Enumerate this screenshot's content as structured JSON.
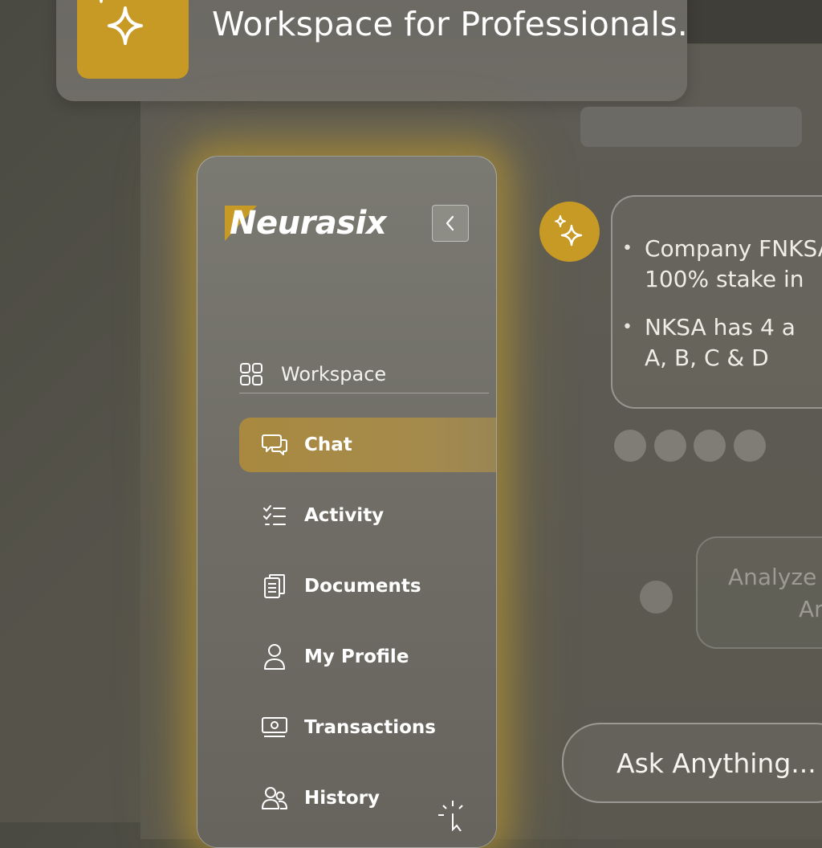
{
  "banner": {
    "title": "Workspace for Professionals.",
    "icon": "sparkles-icon"
  },
  "sidebar": {
    "brand": "Neurasix",
    "collapse_icon": "chevron-left-icon",
    "workspace_label": "Workspace",
    "items": [
      {
        "label": "Chat",
        "icon": "chat-bubbles-icon",
        "active": true
      },
      {
        "label": "Activity",
        "icon": "checklist-icon",
        "active": false
      },
      {
        "label": "Documents",
        "icon": "documents-icon",
        "active": false
      },
      {
        "label": "My Profile",
        "icon": "user-icon",
        "active": false
      },
      {
        "label": "Transactions",
        "icon": "money-icon",
        "active": false
      },
      {
        "label": "History",
        "icon": "users-icon",
        "active": false
      }
    ]
  },
  "chat": {
    "bot_message": [
      "Company FNKSA",
      "100% stake in",
      "NKSA has 4 a",
      "A, B, C & D"
    ],
    "user_message": [
      "Analyze",
      "Ar"
    ],
    "input_placeholder": "Ask Anything..."
  },
  "colors": {
    "accent": "#c69a24",
    "active_item": "#a9893f",
    "glow": "#d6aa28"
  }
}
